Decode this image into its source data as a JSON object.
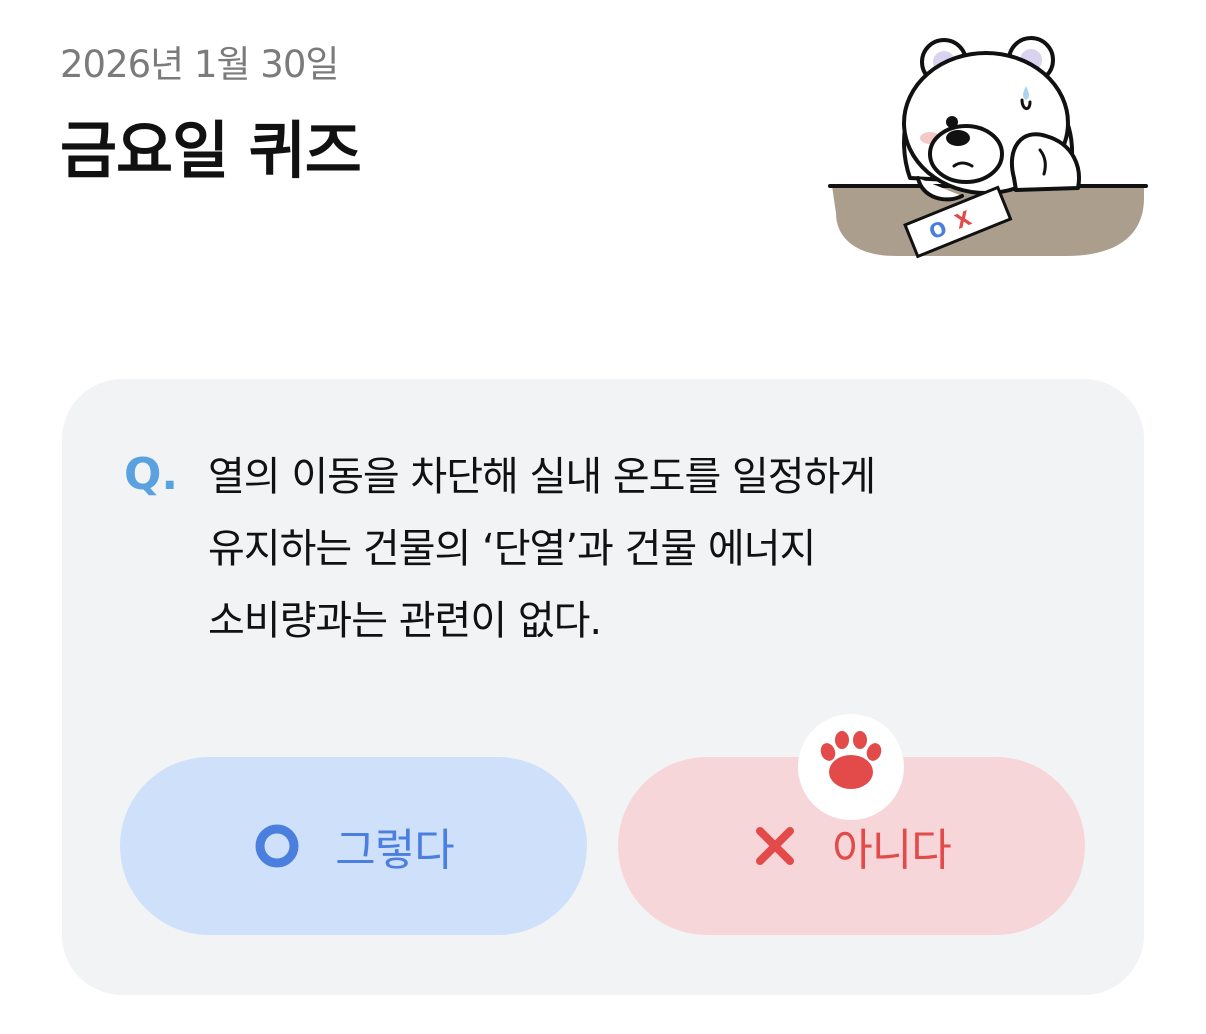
{
  "header": {
    "date": "2026년 1월 30일",
    "title": "금요일 퀴즈"
  },
  "mascot": {
    "paper_text_o": "O",
    "paper_text_x": "X"
  },
  "quiz": {
    "q_mark": "Q.",
    "question": "열의 이동을 차단해 실내 온도를 일정하게\n유지하는 건물의 ‘단열’과 건물 에너지\n소비량과는 관련이 없다."
  },
  "answers": {
    "yes_label": "그렇다",
    "no_label": "아니다"
  },
  "colors": {
    "q_mark": "#5aa2df",
    "yes_bg": "#cfe0fa",
    "yes_fg": "#4a7fe0",
    "no_bg": "#f7d6d9",
    "no_fg": "#e34a4a",
    "card_bg": "#f2f3f5"
  },
  "icons": {
    "yes": "circle-o-icon",
    "no": "x-icon",
    "badge": "paw-icon"
  }
}
